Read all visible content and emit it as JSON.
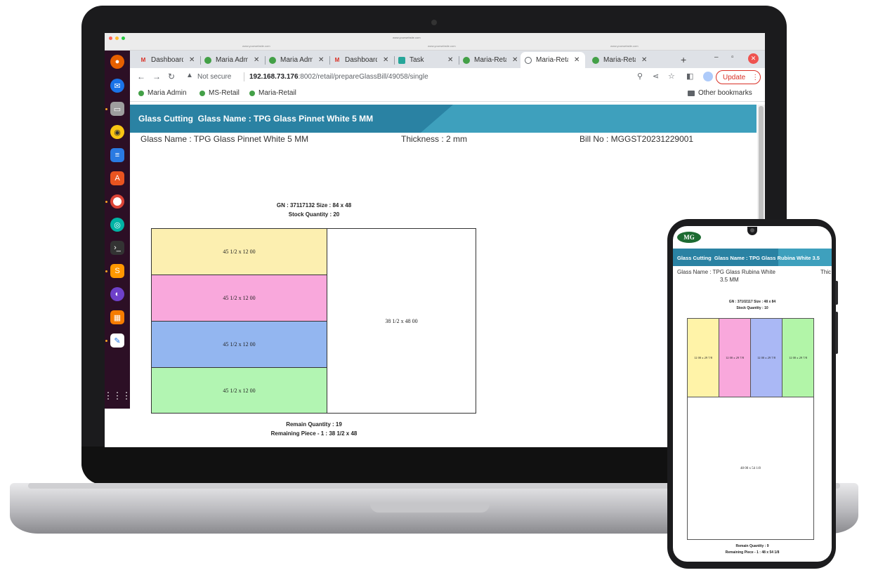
{
  "mac": {
    "url_center": "www.yourwebsite.com",
    "url_left": "www.yourwebsite.com",
    "url_mid": "www.yourwebsite.com",
    "url_right": "www.yourwebsite.com"
  },
  "tabs": [
    {
      "title": "Dashboard",
      "favicon": "gmail-icon"
    },
    {
      "title": "Maria Admin",
      "favicon": "maria-icon"
    },
    {
      "title": "Maria Admin",
      "favicon": "maria-icon"
    },
    {
      "title": "Dashboard",
      "favicon": "gmail-icon"
    },
    {
      "title": "Task",
      "favicon": "cube-icon"
    },
    {
      "title": "Maria-Retail",
      "favicon": "maria-icon"
    },
    {
      "title": "Maria-Retail",
      "favicon": "globe-icon"
    },
    {
      "title": "Maria-Retail",
      "favicon": "maria-icon"
    }
  ],
  "toolbar": {
    "not_secure": "Not secure",
    "url_host": "192.168.73.176",
    "url_path": ":8002/retail/prepareGlassBill/49058/single",
    "update_label": "Update"
  },
  "bookmarks": {
    "items": [
      "Maria Admin",
      "MS-Retail",
      "Maria-Retail"
    ],
    "other": "Other bookmarks"
  },
  "desktop": {
    "header_title": "Glass Cutting  Glass Name : TPG Glass Pinnet White 5 MM",
    "glass_name": "Glass Name : TPG Glass Pinnet White 5 MM",
    "thickness": "Thickness : 2 mm",
    "bill_no": "Bill No : MGGST20231229001",
    "gn_size": "GN : 37117132 Size : 84 x 48",
    "stock_quantity": "Stock Quantity : 20",
    "pieces": [
      {
        "label": "45 1/2 x 12 00",
        "color": "#fcefb0"
      },
      {
        "label": "45 1/2 x 12 00",
        "color": "#f9a8dc"
      },
      {
        "label": "45 1/2 x 12 00",
        "color": "#93b6f0"
      },
      {
        "label": "45 1/2 x 12 00",
        "color": "#b2f5b2"
      }
    ],
    "remaining_label": "38 1/2 x 48 00",
    "remain_quantity": "Remain Quantity : 19",
    "remaining_piece": "Remaining Piece - 1 : 38 1/2 x 48"
  },
  "mobile": {
    "logo": "MG",
    "header_title": "Glass Cutting  Glass Name : TPG Glass Rubina White 3.5",
    "glass_name_line1": "Glass Name : TPG Glass Rubina White",
    "glass_name_line2": "3.5 MM",
    "thickness_partial": "Thic",
    "gn_size": "GN : 37102117 Size : 48 x 84",
    "stock_quantity": "Stock Quantity : 10",
    "pieces": [
      {
        "label": "12 00 x 29 7/8",
        "color": "#fff3a8"
      },
      {
        "label": "12 00 x 29 7/8",
        "color": "#f9a8dc"
      },
      {
        "label": "12 00 x 29 7/8",
        "color": "#aab8f5"
      },
      {
        "label": "12 00 x 29 7/8",
        "color": "#b2f5a8"
      }
    ],
    "remaining_label": "48 00 x 54 1/8",
    "remain_quantity": "Remain Quantity : 9",
    "remaining_piece": "Remaining Piece - 1 : 48 x 54 1/8"
  }
}
